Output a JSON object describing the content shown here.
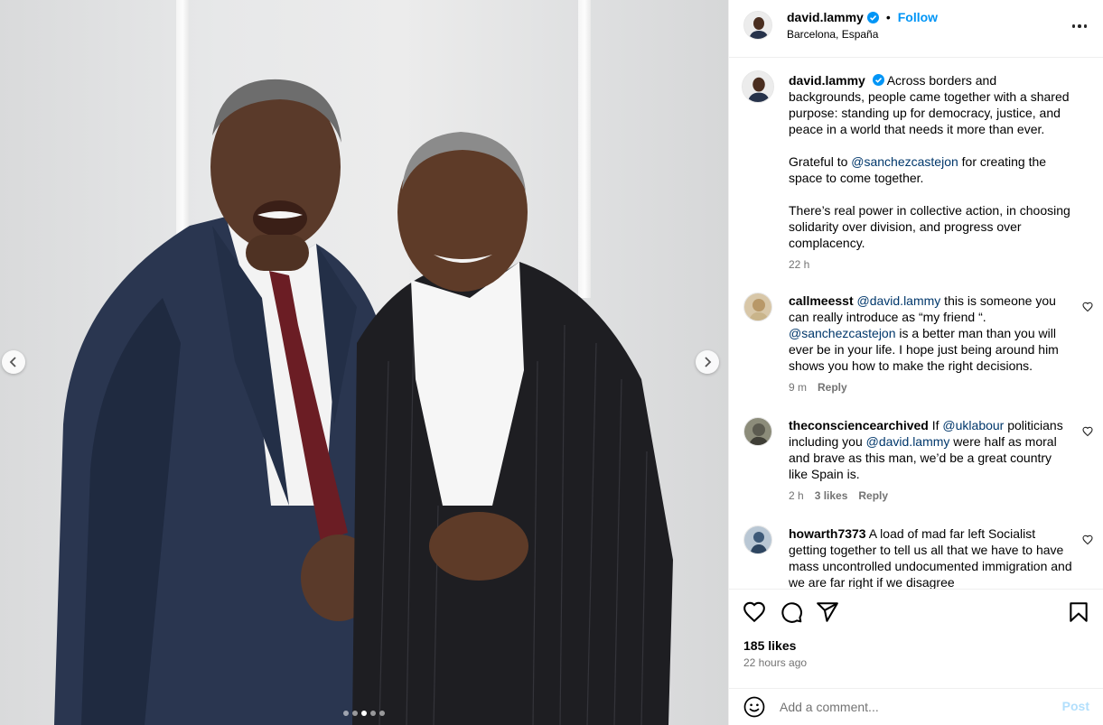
{
  "post": {
    "username": "david.lammy",
    "follow_label": "Follow",
    "separator": "•",
    "location": "Barcelona, España",
    "caption_parts": [
      "Across borders and backgrounds, people came together with a shared purpose: standing up for democracy, justice, and peace in a world that needs it more than ever.",
      "Grateful to ",
      "@sanchezcastejon",
      " for creating the space to come together.",
      "There’s real power in collective action, in choosing solidarity over division, and progress over complacency."
    ],
    "caption_time": "22 h",
    "likes": "185 likes",
    "posted_ago": "22 hours ago"
  },
  "comments": [
    {
      "username": "callmeesst",
      "parts": [
        " ",
        "@david.lammy",
        " this is someone you can really introduce as “my friend “. ",
        "@sanchezcastejon",
        " is a better man than you will ever be in your life. I hope just being around him shows you how to make the right decisions."
      ],
      "time": "9 m",
      "likes": "",
      "reply": "Reply"
    },
    {
      "username": "theconsciencearchived",
      "parts": [
        " If ",
        "@uklabour",
        " politicians including you ",
        "@david.lammy",
        " were half as moral and brave as this man, we’d be a great country like Spain is."
      ],
      "time": "2 h",
      "likes": "3 likes",
      "reply": "Reply"
    },
    {
      "username": "howarth7373",
      "parts": [
        " A load of mad far left Socialist getting together to tell us all that we have to have mass uncontrolled undocumented immigration and we are far right if we disagree"
      ],
      "time": "",
      "likes": "",
      "reply": ""
    }
  ],
  "comment_box": {
    "placeholder": "Add a comment...",
    "post_label": "Post"
  },
  "carousel": {
    "count": 5,
    "active": 2
  },
  "icons": [
    "verified-badge-icon",
    "more-options-icon",
    "heart-icon",
    "comment-icon",
    "share-icon",
    "bookmark-icon",
    "emoji-icon",
    "chevron-left-icon",
    "chevron-right-icon"
  ],
  "colors": {
    "link": "#0095f6",
    "mention": "#00376b",
    "muted": "#737373",
    "post_disabled": "#b2dffc",
    "border": "#efefef"
  }
}
